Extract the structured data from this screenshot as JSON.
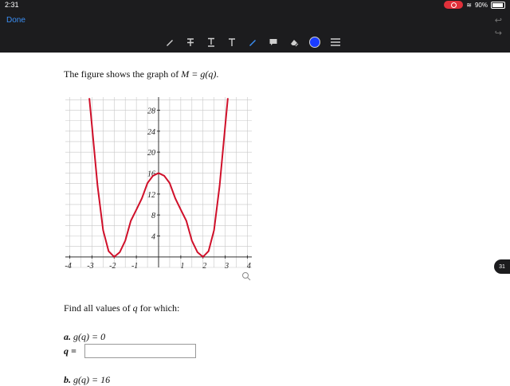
{
  "status": {
    "time": "2:31",
    "battery": "90%",
    "battery_level": 0.9
  },
  "nav": {
    "done_label": "Done",
    "undo_icon": "undo-icon",
    "redo_icon": "redo-icon"
  },
  "toolbar": {
    "tools": [
      {
        "name": "pen-tool",
        "glyph": "✎"
      },
      {
        "name": "strikethrough-text-tool",
        "glyph": "T̶"
      },
      {
        "name": "underline-text-tool",
        "glyph": "T̲"
      },
      {
        "name": "text-tool",
        "glyph": "T"
      },
      {
        "name": "highlighter-tool",
        "glyph": "✎"
      },
      {
        "name": "comment-tool",
        "glyph": "▰"
      },
      {
        "name": "eraser-tool",
        "glyph": "◈"
      }
    ],
    "color": "#1a3cff",
    "accent": "#3b8ff5"
  },
  "problem": {
    "intro_prefix": "The figure shows the graph of ",
    "intro_math": "M = g(q)",
    "intro_suffix": ".",
    "prompt_prefix": "Find all values of ",
    "prompt_var": "q",
    "prompt_suffix": " for which:",
    "part_a_label": "a.",
    "part_a_eq": "g(q) = 0",
    "answer_label": "q =",
    "answer_value": "",
    "part_b_label": "b.",
    "part_b_eq": "g(q) = 16"
  },
  "page_badge": "31",
  "chart_data": {
    "type": "line",
    "series": [
      {
        "x": [
          -3.12,
          -3,
          -2.75,
          -2.5,
          -2.25,
          -2,
          -1.75,
          -1.5,
          -1.25,
          -1,
          -0.75,
          -0.5,
          -0.25,
          0,
          0.25,
          0.5,
          0.75,
          1,
          1.25,
          1.5,
          1.75,
          2,
          2.25,
          2.5,
          2.75,
          3,
          3.12
        ],
        "y": [
          30.3,
          25,
          13.6,
          5.1,
          1.1,
          0,
          0.9,
          3.1,
          6.9,
          9,
          11.2,
          14.1,
          15.5,
          16,
          15.5,
          14.1,
          11.2,
          9,
          6.9,
          3.1,
          0.9,
          0,
          1.1,
          5.1,
          13.6,
          25,
          30.3
        ]
      }
    ],
    "xlim": [
      -4.2,
      4.2
    ],
    "ylim": [
      -2,
      30.5
    ],
    "xticks": [
      -4,
      -3,
      -2,
      -1,
      1,
      2,
      3,
      4
    ],
    "yticks": [
      4,
      8,
      12,
      16,
      20,
      24,
      28
    ],
    "grid": true,
    "line_color": "#d0102a"
  }
}
